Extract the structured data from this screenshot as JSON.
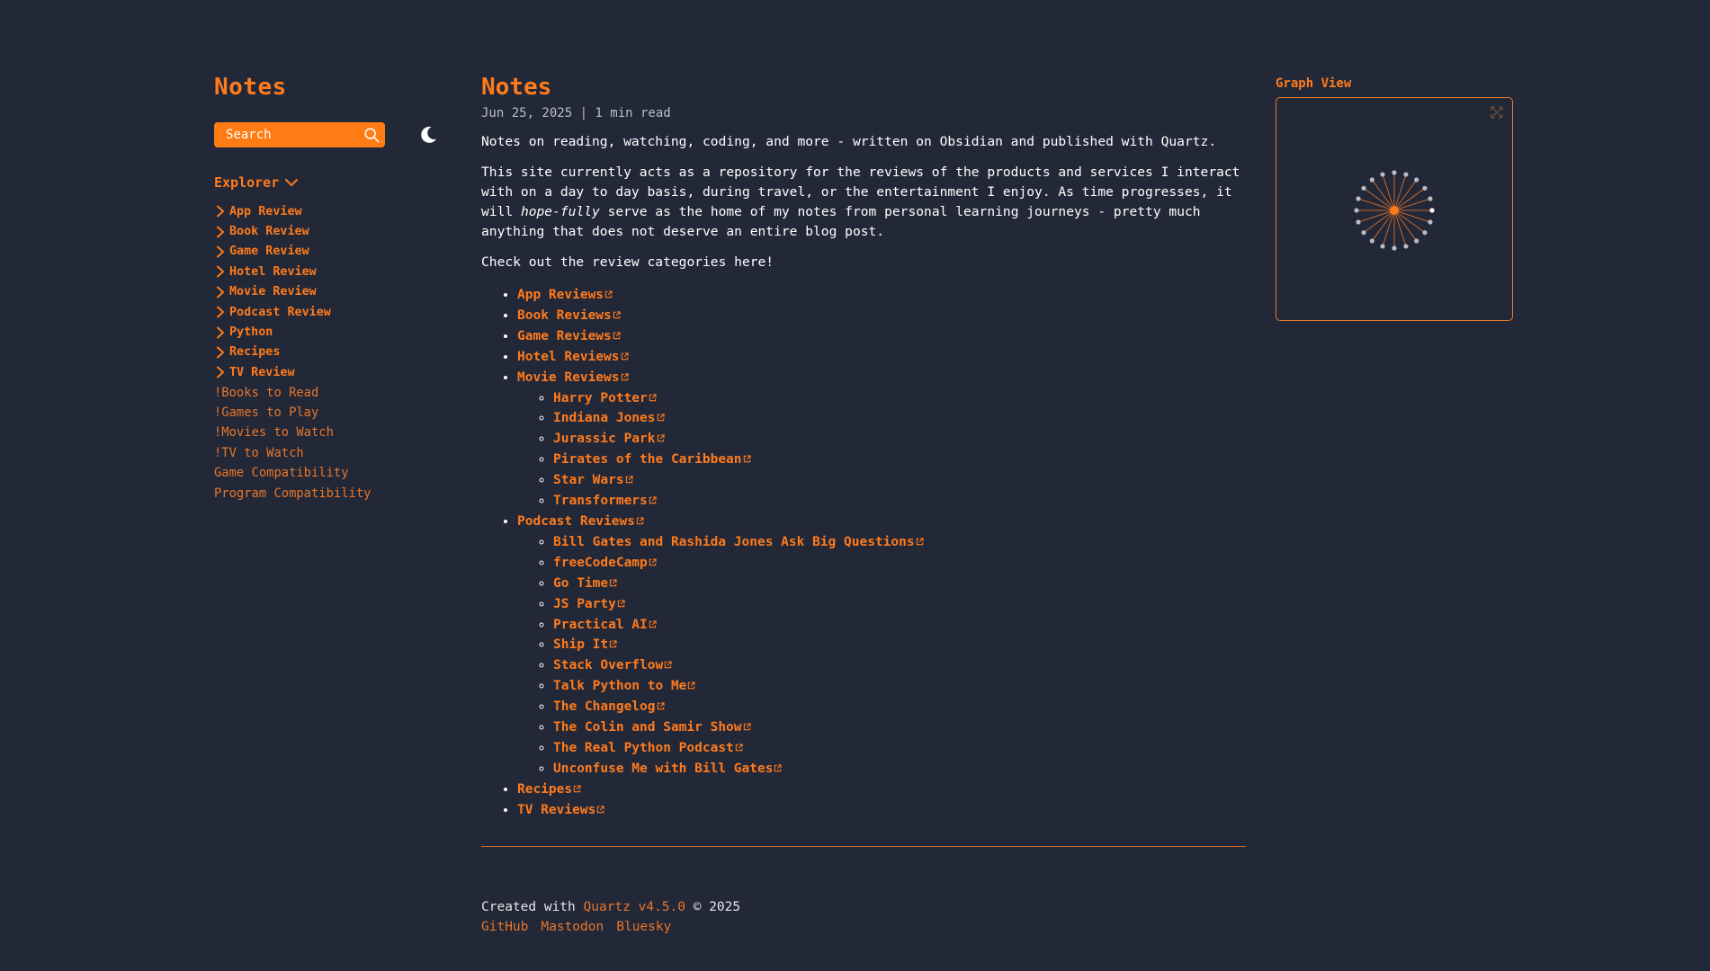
{
  "site": {
    "title": "Notes",
    "search_placeholder": "Search"
  },
  "explorer": {
    "label": "Explorer",
    "folders": [
      "App Review",
      "Book Review",
      "Game Review",
      "Hotel Review",
      "Movie Review",
      "Podcast Review",
      "Python",
      "Recipes",
      "TV Review"
    ],
    "files": [
      "!Books to Read",
      "!Games to Play",
      "!Movies to Watch",
      "!TV to Watch",
      "Game Compatibility",
      "Program Compatibility"
    ]
  },
  "article": {
    "title": "Notes",
    "meta": "Jun 25, 2025 | 1 min read",
    "intro": "Notes on reading, watching, coding, and more - written on Obsidian and published with Quartz.",
    "para2_before": "This site currently acts as a repository for the reviews of the products and services I interact with on a day to day basis, during travel, or the entertainment I enjoy. As time progresses, it will ",
    "para2_em": "hope-fully",
    "para2_after": " serve as the home of my notes from personal learning journeys - pretty much anything that does not deserve an entire blog post.",
    "para3": "Check out the review categories here!",
    "categories": {
      "app": "App Reviews",
      "book": "Book Reviews",
      "game": "Game Reviews",
      "hotel": "Hotel Reviews",
      "movie": "Movie Reviews",
      "movies": [
        "Harry Potter",
        "Indiana Jones",
        "Jurassic Park",
        "Pirates of the Caribbean",
        "Star Wars",
        "Transformers"
      ],
      "podcast": "Podcast Reviews",
      "podcasts": [
        "Bill Gates and Rashida Jones Ask Big Questions",
        "freeCodeCamp",
        "Go Time",
        "JS Party",
        "Practical AI",
        "Ship It",
        "Stack Overflow",
        "Talk Python to Me",
        "The Changelog",
        "The Colin and Samir Show",
        "The Real Python Podcast",
        "Unconfuse Me with Bill Gates"
      ],
      "recipes": "Recipes",
      "tv": "TV Reviews"
    }
  },
  "footer": {
    "created_with": "Created with ",
    "quartz": "Quartz v4.5.0",
    "copyright": " © 2025",
    "links": [
      "GitHub",
      "Mastodon",
      "Bluesky"
    ]
  },
  "graph": {
    "title": "Graph View"
  },
  "colors": {
    "background": "#222838",
    "accent": "#ff7b1c",
    "search_bg": "#ff7b14"
  }
}
